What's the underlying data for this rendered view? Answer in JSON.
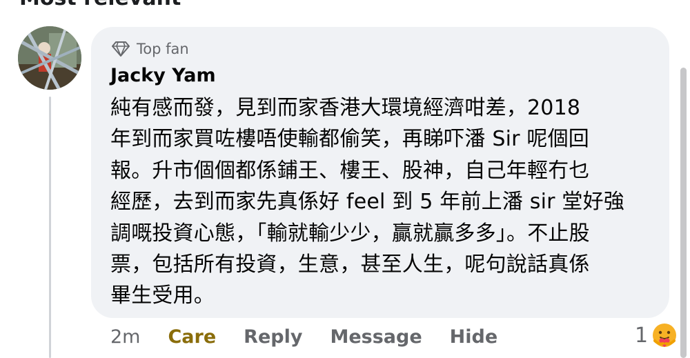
{
  "section_header": "Most relevant",
  "comment": {
    "badge": "Top fan",
    "author": "Jacky Yam",
    "text_lines": [
      "純有感而發，見到而家香港大環境經濟咁差，2018",
      "年到而家買咗樓唔使輸都偷笑，再睇吓潘 Sir 呢個回",
      "報。升市個個都係鋪王、樓王、股神，自己年輕冇乜",
      "經歷，去到而家先真係好 feel 到 5 年前上潘 sir 堂好強",
      "調嘅投資心態，「輸就輸少少，贏就贏多多」。不止股",
      "票，包括所有投資，生意，甚至人生，呢句說話真係",
      "畢生受用。"
    ],
    "time": "2m",
    "actions": {
      "care": "Care",
      "reply": "Reply",
      "message": "Message",
      "hide": "Hide"
    },
    "reaction_count": "1",
    "reaction_icon": "care-emoji-icon"
  },
  "colors": {
    "bubble": "#f0f2f5",
    "care_action": "#8a6d0b",
    "muted": "#65676b"
  }
}
